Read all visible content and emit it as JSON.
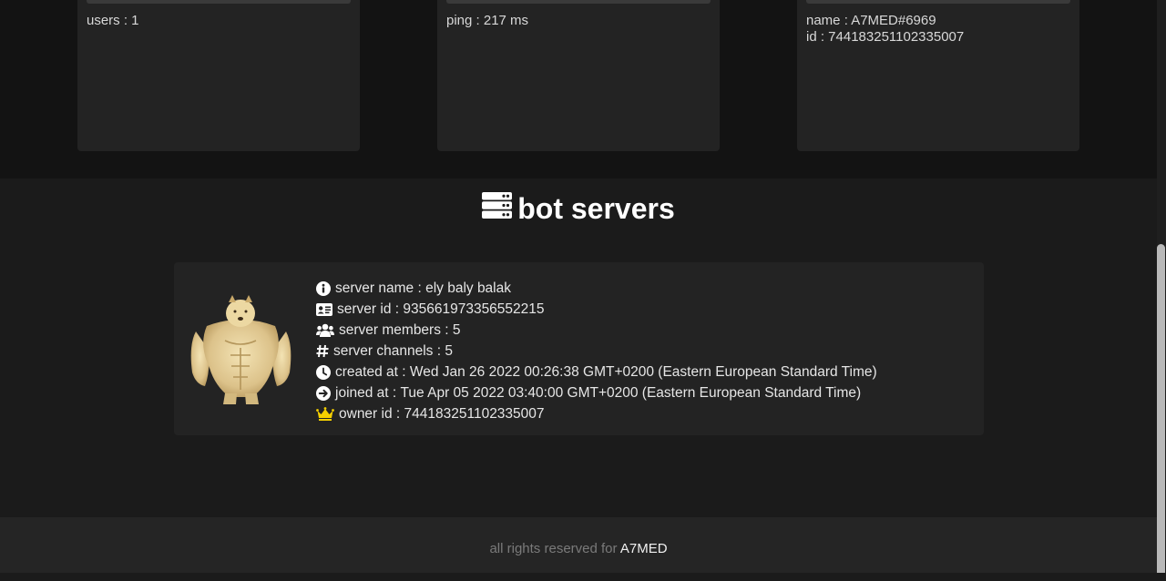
{
  "stats": {
    "users_line": "users : 1",
    "ping_line": "ping : 217 ms",
    "name_line": "name : A7MED#6969",
    "id_line": "id : 744183251102335007"
  },
  "section": {
    "title": "bot servers",
    "icon": "server-icon"
  },
  "server": {
    "avatar_icon": "buff-doge-avatar",
    "rows": [
      {
        "icon": "info-icon",
        "label": "server name",
        "value": "ely baly balak"
      },
      {
        "icon": "id-card-icon",
        "label": "server id",
        "value": "935661973356552215"
      },
      {
        "icon": "users-icon",
        "label": "server members",
        "value": "5"
      },
      {
        "icon": "hashtag-icon",
        "label": "server channels",
        "value": "5"
      },
      {
        "icon": "clock-icon",
        "label": "created at",
        "value": "Wed Jan 26 2022 00:26:38 GMT+0200 (Eastern European Standard Time)"
      },
      {
        "icon": "arrow-circle-icon",
        "label": "joined at",
        "value": "Tue Apr 05 2022 03:40:00 GMT+0200 (Eastern European Standard Time)"
      },
      {
        "icon": "crown-icon",
        "label": "owner id",
        "value": "744183251102335007"
      }
    ]
  },
  "footer": {
    "text": "all rights reserved for",
    "brand": "A7MED"
  },
  "colors": {
    "crown": "#f5d000",
    "background": "#1b1b1b",
    "card": "#232323"
  }
}
